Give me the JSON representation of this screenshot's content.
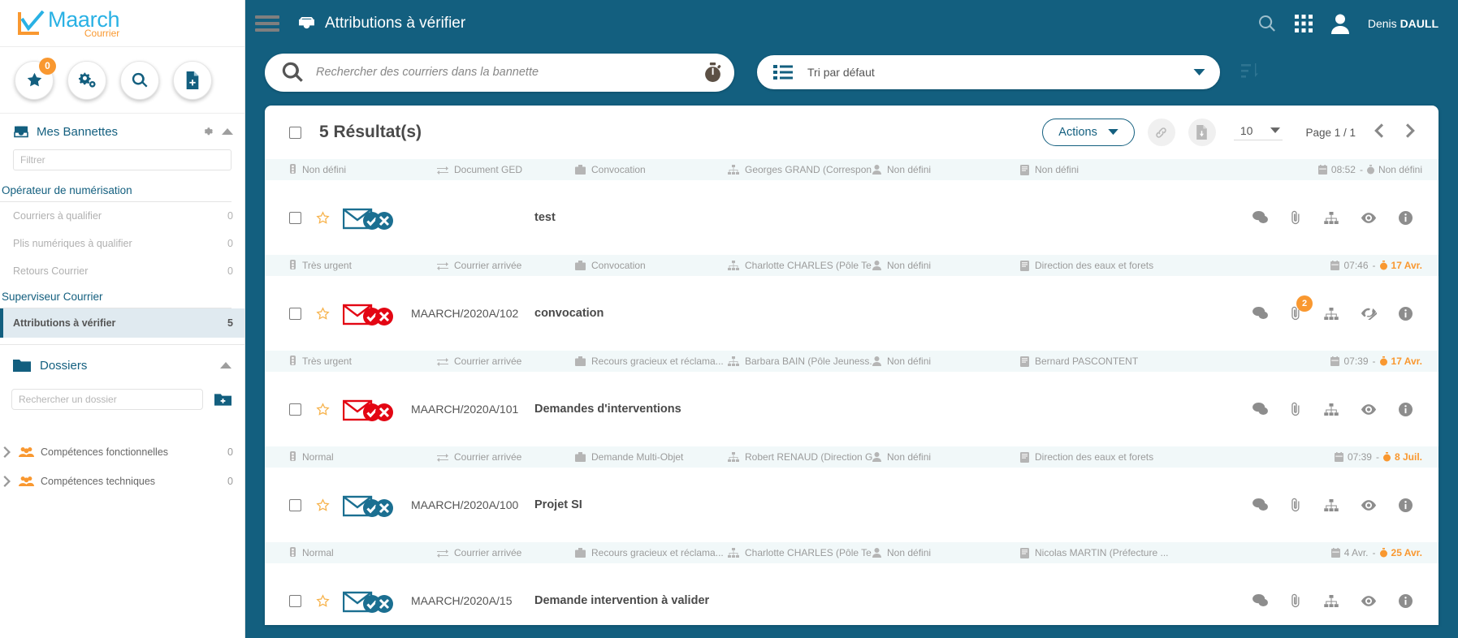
{
  "brand": {
    "name": "Maarch",
    "sub": "Courrier"
  },
  "sidebar": {
    "quick_actions": [
      {
        "name": "favorites",
        "badge": "0"
      },
      {
        "name": "settings-gears",
        "badge": null
      },
      {
        "name": "search",
        "badge": null
      },
      {
        "name": "new-document",
        "badge": null
      }
    ],
    "baskets_title": "Mes Bannettes",
    "filter_placeholder": "Filtrer",
    "groups": [
      {
        "title": "Opérateur de numérisation",
        "items": [
          {
            "label": "Courriers à qualifier",
            "count": "0",
            "active": false
          },
          {
            "label": "Plis numériques à qualifier",
            "count": "0",
            "active": false
          },
          {
            "label": "Retours Courrier",
            "count": "0",
            "active": false
          }
        ]
      },
      {
        "title": "Superviseur Courrier",
        "items": [
          {
            "label": "Attributions à vérifier",
            "count": "5",
            "active": true
          }
        ]
      }
    ],
    "folders_title": "Dossiers",
    "folder_search_placeholder": "Rechercher un dossier",
    "competences": [
      {
        "label": "Compétences fonctionnelles",
        "count": "0"
      },
      {
        "label": "Compétences techniques",
        "count": "0"
      }
    ]
  },
  "header": {
    "title": "Attributions à vérifier",
    "user_first": "Denis",
    "user_last": "DAULL"
  },
  "search": {
    "placeholder": "Rechercher des courriers dans la bannette",
    "value": ""
  },
  "sort": {
    "label": "Tri par défaut"
  },
  "toolbar": {
    "results_label": "5 Résultat(s)",
    "actions_label": "Actions",
    "per_page": "10",
    "page_info": "Page 1 / 1"
  },
  "rows": [
    {
      "meta": {
        "priority": "Non défini",
        "type": "Document GED",
        "category": "Convocation",
        "dest": "Georges GRAND (Correspon...",
        "user": "Non défini",
        "doc": "Non défini",
        "time": "08:52",
        "due": "Non défini",
        "due_highlight": false
      },
      "chrono": "",
      "subject": "test",
      "envelope": "blue",
      "attach_badge": null,
      "eye": "visible"
    },
    {
      "meta": {
        "priority": "Très urgent",
        "type": "Courrier arrivée",
        "category": "Convocation",
        "dest": "Charlotte CHARLES (Pôle Te...",
        "user": "Non défini",
        "doc": "Direction des eaux et forets",
        "time": "07:46",
        "due": "17 Avr.",
        "due_highlight": true
      },
      "chrono": "MAARCH/2020A/102",
      "subject": "convocation",
      "envelope": "red",
      "attach_badge": "2",
      "eye": "hidden"
    },
    {
      "meta": {
        "priority": "Très urgent",
        "type": "Courrier arrivée",
        "category": "Recours gracieux et réclama...",
        "dest": "Barbara BAIN (Pôle Jeuness...",
        "user": "Non défini",
        "doc": "Bernard PASCONTENT",
        "time": "07:39",
        "due": "17 Avr.",
        "due_highlight": true
      },
      "chrono": "MAARCH/2020A/101",
      "subject": "Demandes d'interventions",
      "envelope": "red",
      "attach_badge": null,
      "eye": "visible"
    },
    {
      "meta": {
        "priority": "Normal",
        "type": "Courrier arrivée",
        "category": "Demande Multi-Objet",
        "dest": "Robert RENAUD (Direction G...",
        "user": "Non défini",
        "doc": "Direction des eaux et forets",
        "time": "07:39",
        "due": "8 Juil.",
        "due_highlight": true
      },
      "chrono": "MAARCH/2020A/100",
      "subject": "Projet SI",
      "envelope": "blue",
      "attach_badge": null,
      "eye": "visible"
    },
    {
      "meta": {
        "priority": "Normal",
        "type": "Courrier arrivée",
        "category": "Recours gracieux et réclama...",
        "dest": "Charlotte CHARLES (Pôle Te...",
        "user": "Non défini",
        "doc": "Nicolas MARTIN (Préfecture ...",
        "time": "4 Avr.",
        "due": "25 Avr.",
        "due_highlight": true
      },
      "chrono": "MAARCH/2020A/15",
      "subject": "Demande intervention à valider",
      "envelope": "blue",
      "attach_badge": null,
      "eye": "visible"
    }
  ],
  "colors": {
    "primary": "#135f7f",
    "accent_orange": "#f99830",
    "logo_blue": "#29b1e4",
    "urgent_red": "#e30613"
  }
}
